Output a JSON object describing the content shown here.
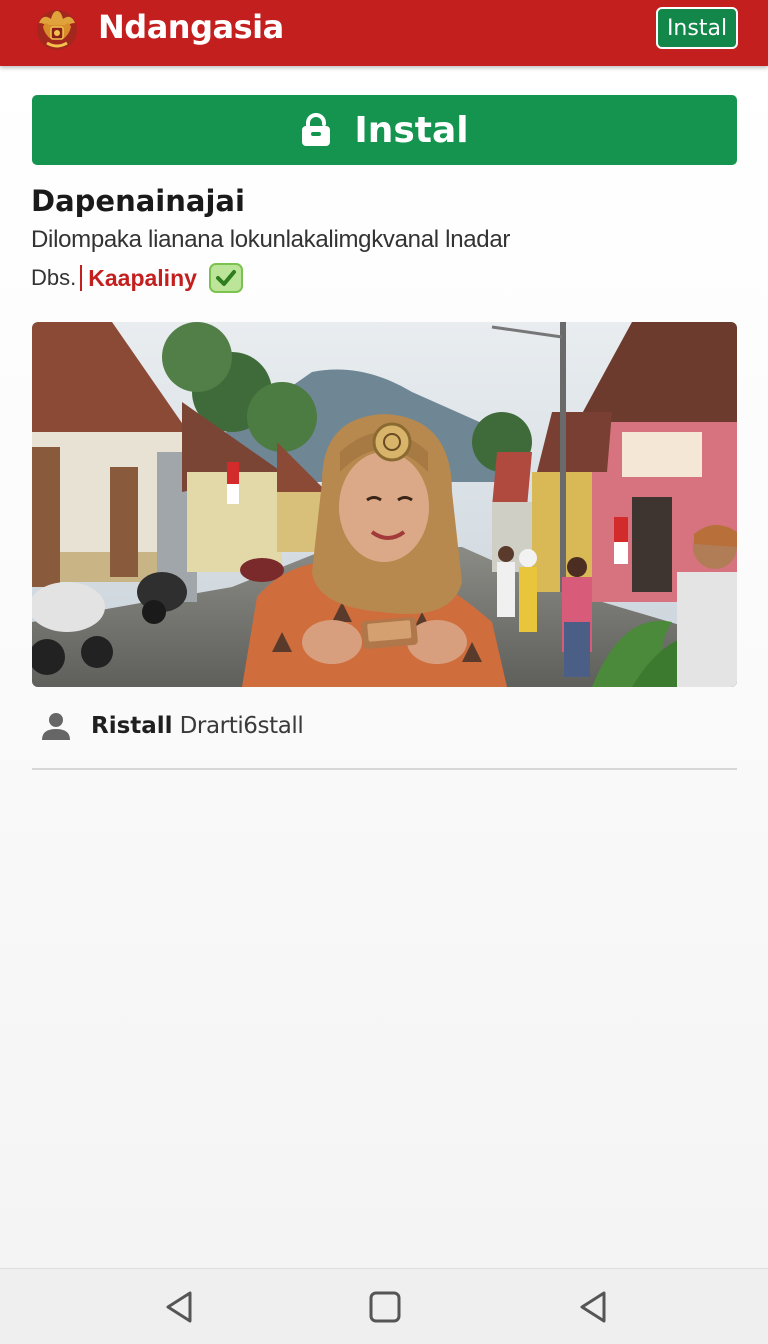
{
  "header": {
    "app_title": "Ndangasia",
    "install_label": "Instal",
    "bg_color": "#c41f1f"
  },
  "main": {
    "install_button_label": "Instal",
    "install_button_color": "#15944f",
    "lock_icon": "lock-icon",
    "app_name": "Dapenainajai",
    "description": "Dilompaka lianana lokunlakalimgkvanal lnadar",
    "meta_prefix": "Dbs.",
    "publisher": "Kaapaliny",
    "verified_icon": "check-badge-icon",
    "author_icon": "person-icon",
    "author_name": "Ristall",
    "author_sub": "Drarti6stall"
  },
  "navbar": {
    "back_icon": "back-triangle-icon",
    "home_icon": "home-square-icon",
    "recents_icon": "recents-triangle-icon"
  }
}
